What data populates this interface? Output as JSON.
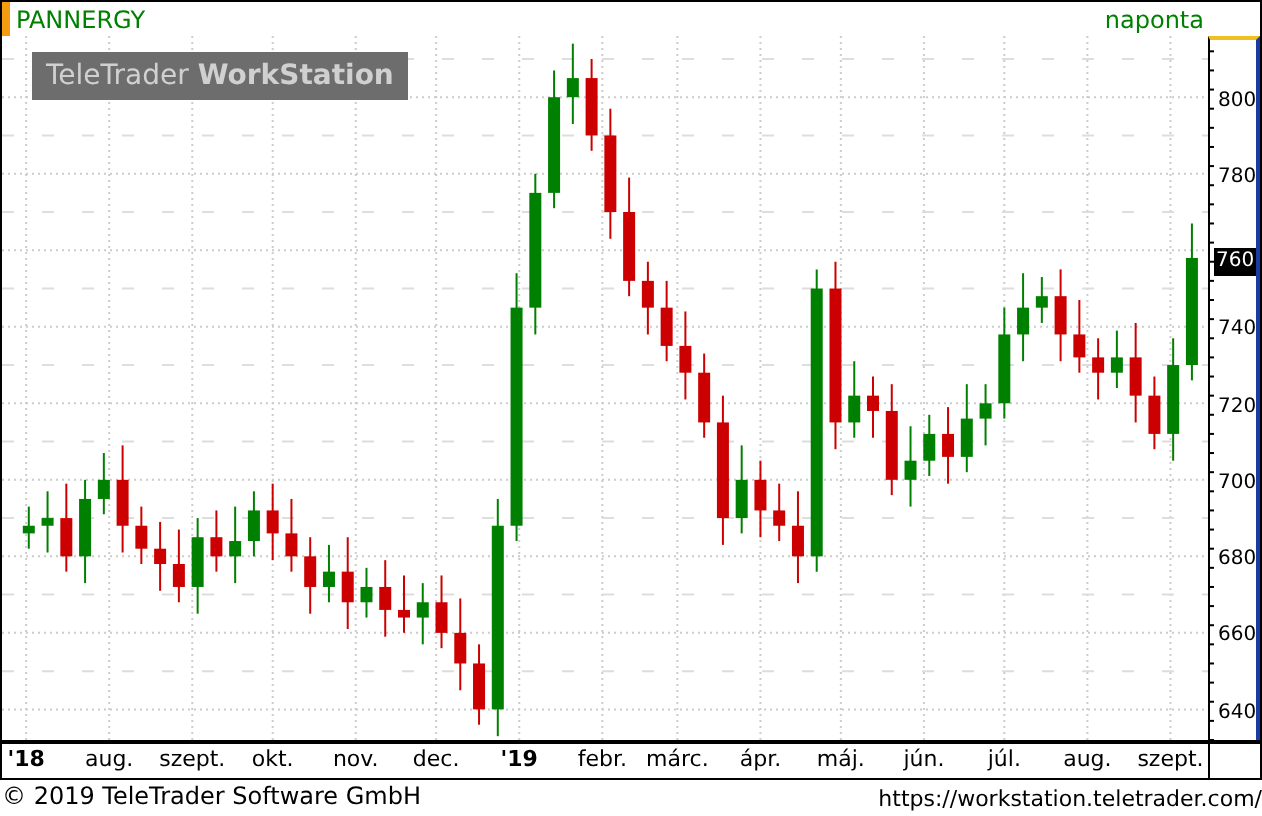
{
  "header": {
    "interval": "naponta"
  },
  "brand": "TeleTrader **WorkStation**",
  "chart_data": {
    "type": "candlestick",
    "ylim": [
      632,
      816
    ],
    "xlim": [
      "2018-06-22",
      "2019-09-15"
    ],
    "grid": true,
    "yticks": [
      {
        "value": 640,
        "label": "640"
      },
      {
        "value": 660,
        "label": "660"
      },
      {
        "value": 680,
        "label": "680"
      },
      {
        "value": 700,
        "label": "700"
      },
      {
        "value": 720,
        "label": "720"
      },
      {
        "value": 740,
        "label": "740"
      },
      {
        "value": 780,
        "label": "780"
      },
      {
        "value": 800,
        "label": "800"
      }
    ],
    "xticks": [
      {
        "value": "2018-07-01",
        "label": "**'18**"
      },
      {
        "value": "2018-08-01",
        "label": "aug."
      },
      {
        "value": "2018-09-01",
        "label": "szept."
      },
      {
        "value": "2018-10-01",
        "label": "okt."
      },
      {
        "value": "2018-11-01",
        "label": "nov."
      },
      {
        "value": "2018-12-01",
        "label": "dec."
      },
      {
        "value": "2019-01-01",
        "label": "**'19**"
      },
      {
        "value": "2019-02-01",
        "label": "febr."
      },
      {
        "value": "2019-03-01",
        "label": "márc."
      },
      {
        "value": "2019-04-01",
        "label": "ápr."
      },
      {
        "value": "2019-05-01",
        "label": "máj."
      },
      {
        "value": "2019-06-01",
        "label": "jún."
      },
      {
        "value": "2019-07-01",
        "label": "júl."
      },
      {
        "value": "2019-08-01",
        "label": "aug."
      },
      {
        "value": "2019-09-01",
        "label": "szept."
      }
    ],
    "x": [
      "2018-07-02",
      "2018-07-09",
      "2018-07-16",
      "2018-07-23",
      "2018-07-30",
      "2018-08-06",
      "2018-08-13",
      "2018-08-20",
      "2018-08-27",
      "2018-09-03",
      "2018-09-10",
      "2018-09-17",
      "2018-09-24",
      "2018-10-01",
      "2018-10-08",
      "2018-10-15",
      "2018-10-22",
      "2018-10-29",
      "2018-11-05",
      "2018-11-12",
      "2018-11-19",
      "2018-11-26",
      "2018-12-03",
      "2018-12-10",
      "2018-12-17",
      "2018-12-24",
      "2018-12-31",
      "2019-01-07",
      "2019-01-14",
      "2019-01-21",
      "2019-01-28",
      "2019-02-04",
      "2019-02-11",
      "2019-02-18",
      "2019-02-25",
      "2019-03-04",
      "2019-03-11",
      "2019-03-18",
      "2019-03-25",
      "2019-04-01",
      "2019-04-08",
      "2019-04-15",
      "2019-04-22",
      "2019-04-29",
      "2019-05-06",
      "2019-05-13",
      "2019-05-20",
      "2019-05-27",
      "2019-06-03",
      "2019-06-10",
      "2019-06-17",
      "2019-06-24",
      "2019-07-01",
      "2019-07-08",
      "2019-07-15",
      "2019-07-22",
      "2019-07-29",
      "2019-08-05",
      "2019-08-12",
      "2019-08-19",
      "2019-08-26",
      "2019-09-02",
      "2019-09-09"
    ],
    "series": [
      {
        "name": "PANNERGY",
        "ohlc": [
          [
            686,
            693,
            682,
            688
          ],
          [
            688,
            697,
            681,
            690
          ],
          [
            690,
            699,
            676,
            680
          ],
          [
            680,
            700,
            673,
            695
          ],
          [
            695,
            707,
            691,
            700
          ],
          [
            700,
            709,
            681,
            688
          ],
          [
            688,
            693,
            678,
            682
          ],
          [
            682,
            689,
            671,
            678
          ],
          [
            678,
            687,
            668,
            672
          ],
          [
            672,
            690,
            665,
            685
          ],
          [
            685,
            692,
            676,
            680
          ],
          [
            680,
            693,
            673,
            684
          ],
          [
            684,
            697,
            680,
            692
          ],
          [
            692,
            699,
            679,
            686
          ],
          [
            686,
            695,
            676,
            680
          ],
          [
            680,
            685,
            665,
            672
          ],
          [
            672,
            683,
            668,
            676
          ],
          [
            676,
            685,
            661,
            668
          ],
          [
            668,
            677,
            664,
            672
          ],
          [
            672,
            679,
            659,
            666
          ],
          [
            666,
            675,
            660,
            664
          ],
          [
            664,
            673,
            657,
            668
          ],
          [
            668,
            675,
            656,
            660
          ],
          [
            660,
            669,
            645,
            652
          ],
          [
            652,
            657,
            636,
            640
          ],
          [
            640,
            695,
            633,
            688
          ],
          [
            688,
            754,
            684,
            745
          ],
          [
            745,
            780,
            738,
            775
          ],
          [
            775,
            807,
            771,
            800
          ],
          [
            800,
            814,
            793,
            805
          ],
          [
            805,
            810,
            786,
            790
          ],
          [
            790,
            797,
            763,
            770
          ],
          [
            770,
            779,
            748,
            752
          ],
          [
            752,
            757,
            738,
            745
          ],
          [
            745,
            752,
            731,
            735
          ],
          [
            735,
            744,
            721,
            728
          ],
          [
            728,
            733,
            711,
            715
          ],
          [
            715,
            722,
            683,
            690
          ],
          [
            690,
            709,
            686,
            700
          ],
          [
            700,
            705,
            685,
            692
          ],
          [
            692,
            699,
            684,
            688
          ],
          [
            688,
            697,
            673,
            680
          ],
          [
            680,
            755,
            676,
            750
          ],
          [
            750,
            757,
            708,
            715
          ],
          [
            715,
            731,
            711,
            722
          ],
          [
            722,
            727,
            711,
            718
          ],
          [
            718,
            725,
            696,
            700
          ],
          [
            700,
            714,
            693,
            705
          ],
          [
            705,
            717,
            701,
            712
          ],
          [
            712,
            719,
            699,
            706
          ],
          [
            706,
            725,
            702,
            716
          ],
          [
            716,
            725,
            709,
            720
          ],
          [
            720,
            745,
            716,
            738
          ],
          [
            738,
            754,
            731,
            745
          ],
          [
            745,
            753,
            741,
            748
          ],
          [
            748,
            755,
            731,
            738
          ],
          [
            738,
            747,
            728,
            732
          ],
          [
            732,
            737,
            721,
            728
          ],
          [
            728,
            739,
            724,
            732
          ],
          [
            732,
            741,
            715,
            722
          ],
          [
            722,
            727,
            708,
            712
          ],
          [
            712,
            737,
            705,
            730
          ],
          [
            730,
            767,
            726,
            758
          ]
        ]
      }
    ]
  },
  "last_price": {
    "label": "760"
  },
  "footer": {
    "copyright": "© 2019 TeleTrader Software GmbH",
    "url": "https://workstation.teletrader.com/"
  }
}
